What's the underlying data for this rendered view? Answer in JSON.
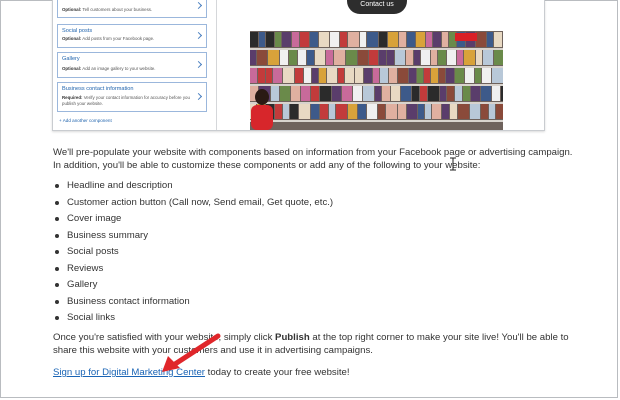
{
  "embedded_preview": {
    "components": [
      {
        "title": "",
        "desc_prefix": "Optional:",
        "desc": "Tell customers about your business."
      },
      {
        "title": "Social posts",
        "desc_prefix": "Optional:",
        "desc": "Add posts from your Facebook page."
      },
      {
        "title": "Gallery",
        "desc_prefix": "Optional:",
        "desc": "Add an image gallery to your website."
      },
      {
        "title": "Business contact information",
        "desc_prefix": "Required:",
        "desc": "Verify your contact information for accuracy before you publish your website."
      }
    ],
    "add_component": "+ Add another component",
    "contact_button": "Contact us"
  },
  "intro": "We'll pre-populate your website with components based on information from your Facebook page or advertising campaign. In addition, you'll be able to customize these components or add any of the following to your website:",
  "features": [
    "Headline and description",
    "Customer action button (Call now, Send email, Get quote, etc.)",
    "Cover image",
    "Business summary",
    "Social posts",
    "Reviews",
    "Gallery",
    "Business contact information",
    "Social links"
  ],
  "publish_para": {
    "before": "Once you're satisfied with your website, simply click ",
    "bold": "Publish",
    "after": " at the top right corner to make your site live! You'll be able to share this website with your customers and use it in advertising campaigns."
  },
  "signup": {
    "link": "Sign up for Digital Marketing Center",
    "rest": " today to create your free website!"
  },
  "colors": {
    "link": "#1a64b5",
    "arrow": "#e0262a",
    "text": "#333333"
  }
}
